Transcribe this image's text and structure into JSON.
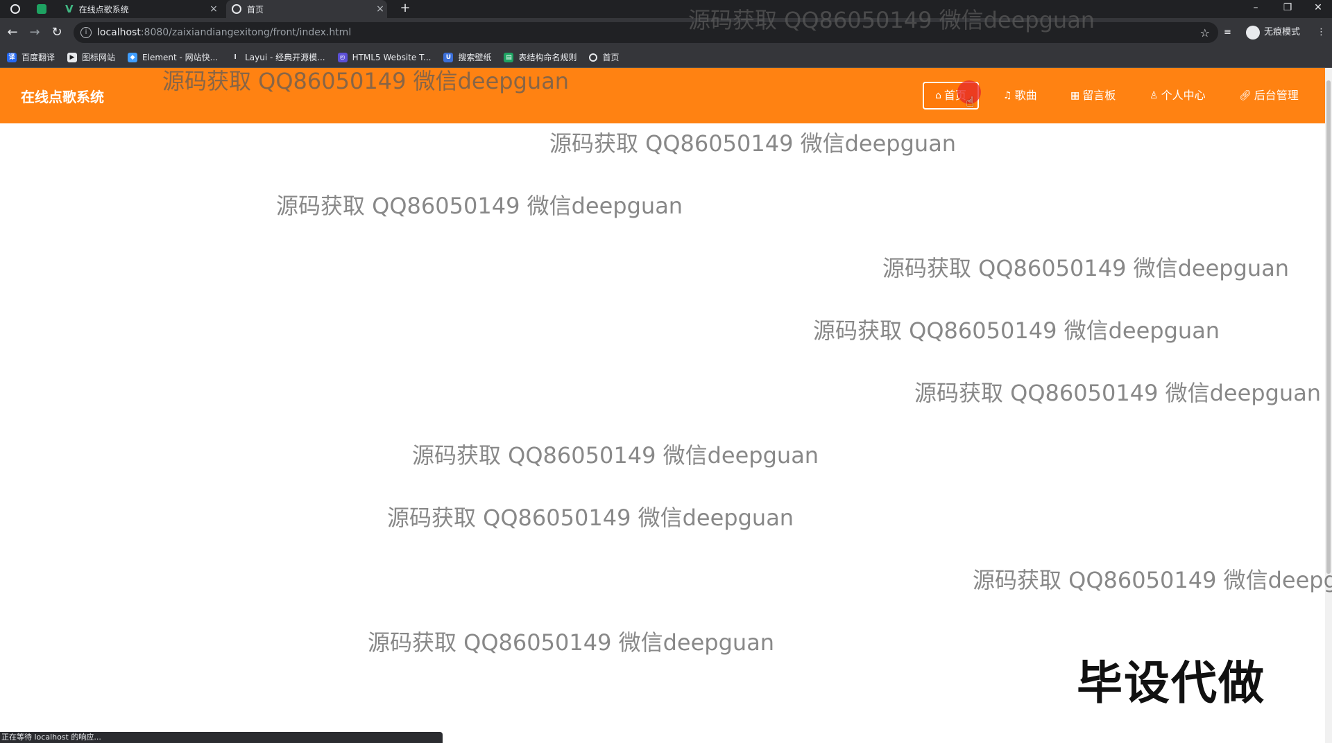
{
  "browser": {
    "tabs": [
      {
        "title": "在线点歌系统",
        "close": "×"
      },
      {
        "title": "首页",
        "close": "×"
      }
    ],
    "new_tab": "+",
    "window_controls": {
      "minimize": "–",
      "restore": "❐",
      "close": "✕"
    },
    "address": {
      "host": "localhost",
      "path": ":8080/zaixiandiangexitong/front/index.html"
    },
    "incognito_label": "无痕模式",
    "bookmarks": [
      "百度翻译",
      "图标网站",
      "Element - 网站快...",
      "Layui - 经典开源模...",
      "HTML5 Website T...",
      "搜索壁纸",
      "表结构命名规则",
      "首页"
    ],
    "status_text": "正在等待 localhost 的响应..."
  },
  "site": {
    "brand": "在线点歌系统",
    "nav": [
      {
        "label": "首页",
        "icon": "home-icon",
        "active": true
      },
      {
        "label": "歌曲",
        "icon": "music-icon",
        "active": false
      },
      {
        "label": "留言板",
        "icon": "message-icon",
        "active": false
      },
      {
        "label": "个人中心",
        "icon": "user-icon",
        "active": false
      },
      {
        "label": "后台管理",
        "icon": "link-icon",
        "active": false
      }
    ],
    "accent_color": "#ff8212"
  },
  "overlay": {
    "watermark_text": "源码获取 QQ86050149 微信deepguan",
    "watermark_text_cut": "源码获取 QQ86050149 微信deepgua",
    "stamp": "毕设代做"
  }
}
